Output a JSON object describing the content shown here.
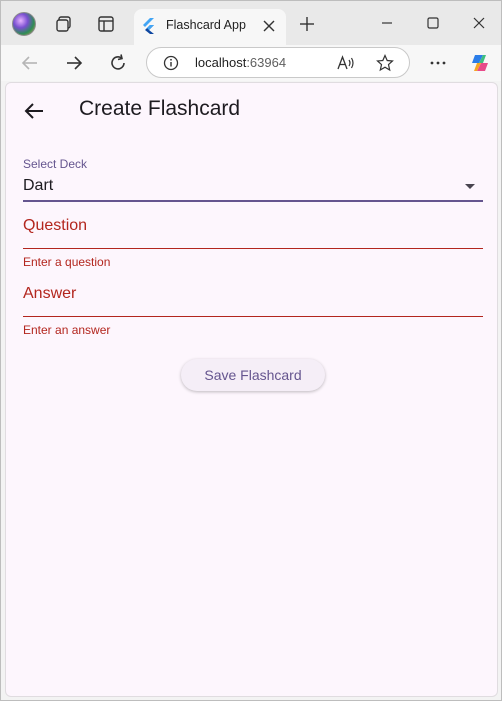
{
  "browser": {
    "tab_title": "Flashcard App",
    "url_host": "localhost",
    "url_port": ":63964"
  },
  "app": {
    "title": "Create Flashcard",
    "deck_select": {
      "label": "Select Deck",
      "value": "Dart"
    },
    "question_field": {
      "label": "Question",
      "error": "Enter a question"
    },
    "answer_field": {
      "label": "Answer",
      "error": "Enter an answer"
    },
    "save_label": "Save Flashcard"
  },
  "colors": {
    "primary": "#65558f",
    "error": "#b3261e",
    "surface": "#fdf6fd"
  }
}
